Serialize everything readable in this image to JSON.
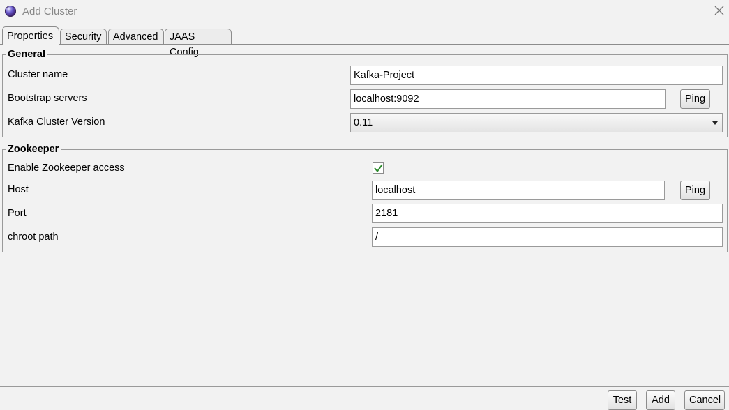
{
  "window": {
    "title": "Add Cluster"
  },
  "tabs": [
    {
      "label": "Properties",
      "active": true
    },
    {
      "label": "Security",
      "active": false
    },
    {
      "label": "Advanced",
      "active": false
    },
    {
      "label": "JAAS Config",
      "active": false
    }
  ],
  "general": {
    "legend": "General",
    "cluster_name_label": "Cluster name",
    "cluster_name_value": "Kafka-Project",
    "bootstrap_label": "Bootstrap servers",
    "bootstrap_value": "localhost:9092",
    "bootstrap_ping_label": "Ping",
    "version_label": "Kafka Cluster Version",
    "version_value": "0.11"
  },
  "zookeeper": {
    "legend": "Zookeeper",
    "enable_label": "Enable Zookeeper access",
    "enable_checked": true,
    "host_label": "Host",
    "host_value": "localhost",
    "host_ping_label": "Ping",
    "port_label": "Port",
    "port_value": "2181",
    "chroot_label": "chroot path",
    "chroot_value": "/"
  },
  "footer": {
    "test_label": "Test",
    "add_label": "Add",
    "cancel_label": "Cancel"
  },
  "colors": {
    "background": "#f2f2f2",
    "check": "#2e8b2e"
  }
}
